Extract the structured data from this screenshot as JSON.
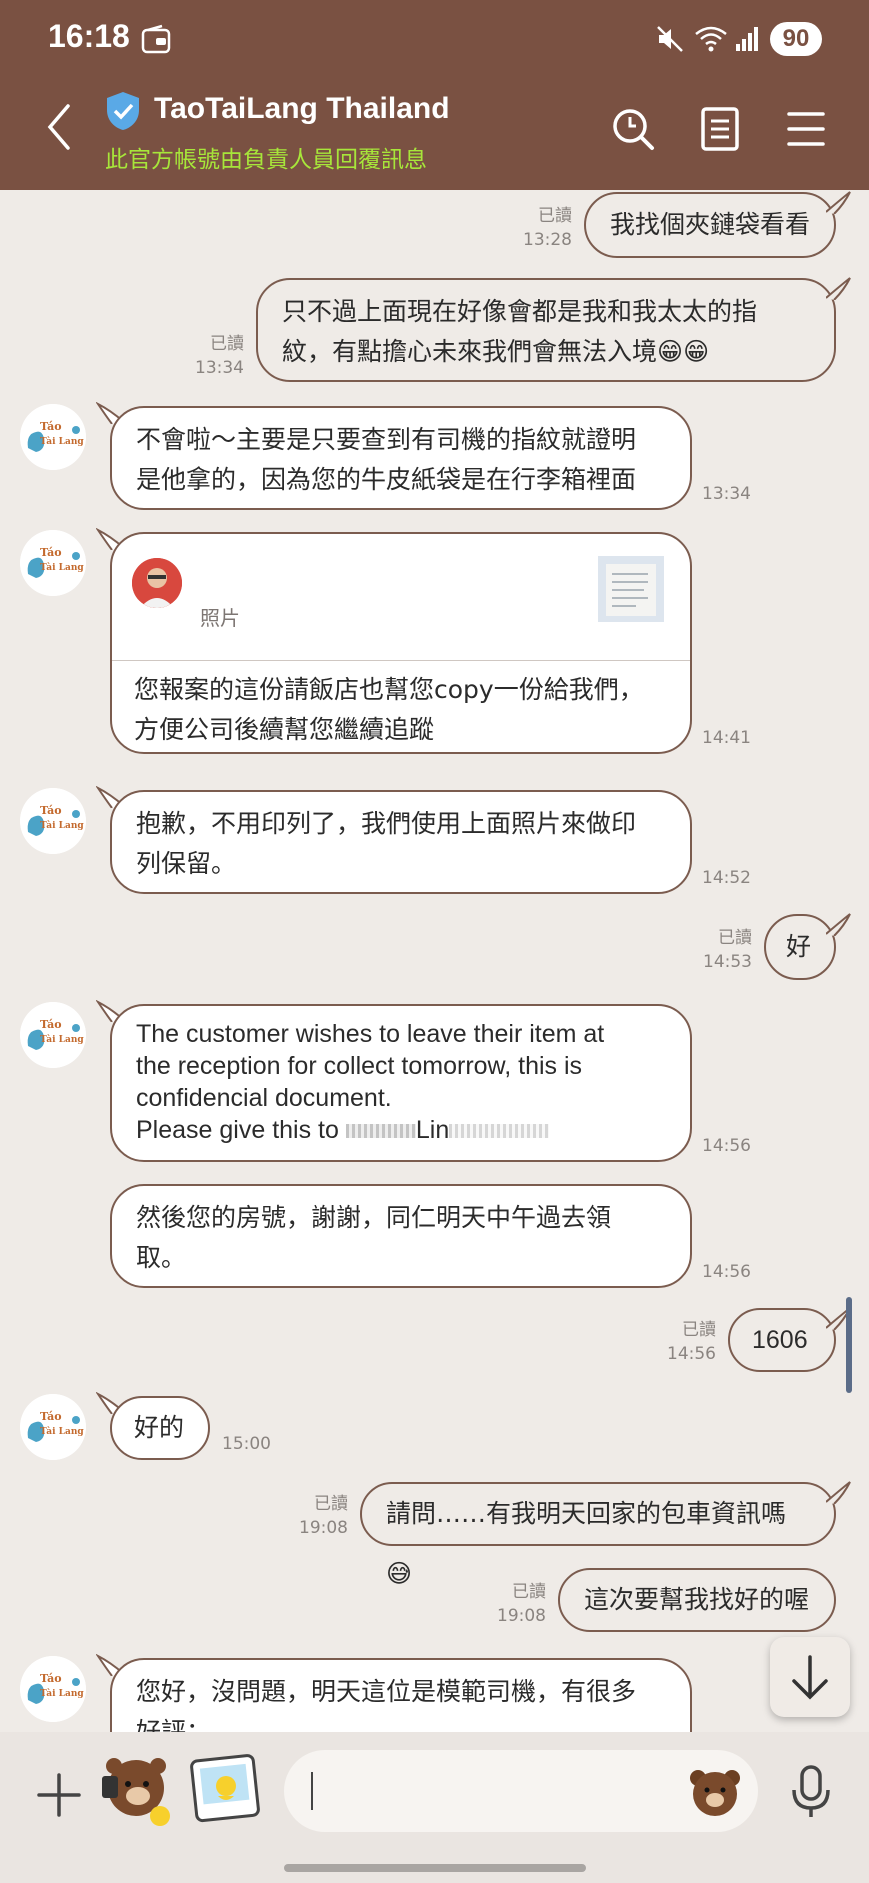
{
  "status_bar": {
    "time": "16:18",
    "battery": "90"
  },
  "header": {
    "title": "TaoTaiLang Thailand",
    "subtitle": "此官方帳號由負責人員回覆訊息",
    "icons": [
      "back-icon",
      "shield-check-icon",
      "search-icon",
      "notes-icon",
      "menu-icon"
    ]
  },
  "messages": [
    {
      "side": "me",
      "text": "我找個夾鏈袋看看",
      "read": "已讀",
      "time": "13:28"
    },
    {
      "side": "me",
      "lines": [
        "只不過上面現在好像會都是我和我太太的指",
        "紋，有點擔心未來我們會無法入境😁😁"
      ],
      "read": "已讀",
      "time": "13:34"
    },
    {
      "side": "them",
      "lines": [
        "不會啦～主要是只要查到有司機的指紋就證明",
        "是他拿的，因為您的牛皮紙袋是在行李箱裡面"
      ],
      "time": "13:34"
    },
    {
      "side": "them",
      "card_label": "照片",
      "lines": [
        "您報案的這份請飯店也幫您copy一份給我們，",
        "方便公司後續幫您繼續追蹤"
      ],
      "time": "14:41"
    },
    {
      "side": "them",
      "lines": [
        "抱歉，不用印列了，我們使用上面照片來做印",
        "列保留。"
      ],
      "time": "14:52"
    },
    {
      "side": "me",
      "text": "好",
      "read": "已讀",
      "time": "14:53"
    },
    {
      "side": "them",
      "lines": [
        "The customer wishes to leave their item at",
        "the reception for collect tomorrow, this is",
        "confidencial document.",
        "Please give this to"
      ],
      "name_fragment": "Lin",
      "time": "14:56"
    },
    {
      "side": "them",
      "lines": [
        "然後您的房號，謝謝，同仁明天中午過去領",
        "取。"
      ],
      "time": "14:56"
    },
    {
      "side": "me",
      "text": "1606",
      "read": "已讀",
      "time": "14:56"
    },
    {
      "side": "them",
      "text": "好的",
      "time": "15:00"
    },
    {
      "side": "me",
      "text": "請問……有我明天回家的包車資訊嗎😅",
      "read": "已讀",
      "time": "19:08"
    },
    {
      "side": "me",
      "text": "這次要幫我找好的喔",
      "read": "已讀",
      "time": "19:08"
    },
    {
      "side": "them",
      "lines": [
        "您好，沒問題，明天這位是模範司機，有很多",
        "好評："
      ]
    }
  ],
  "avatar": {
    "line1": "Táo",
    "line2": "Tài Lang"
  },
  "colors": {
    "header": "#7a5142",
    "subtitle": "#a7e63a",
    "chat_bg": "#efebe7",
    "bubble_border": "#7b5c4f",
    "bubble_me": "#efebe7",
    "bubble_them": "#ffffff"
  },
  "bottom_bar": {
    "icons": [
      "plus-icon",
      "bear-sticker-icon",
      "photo-sticker-icon",
      "emoji-bear-icon",
      "microphone-icon"
    ]
  }
}
